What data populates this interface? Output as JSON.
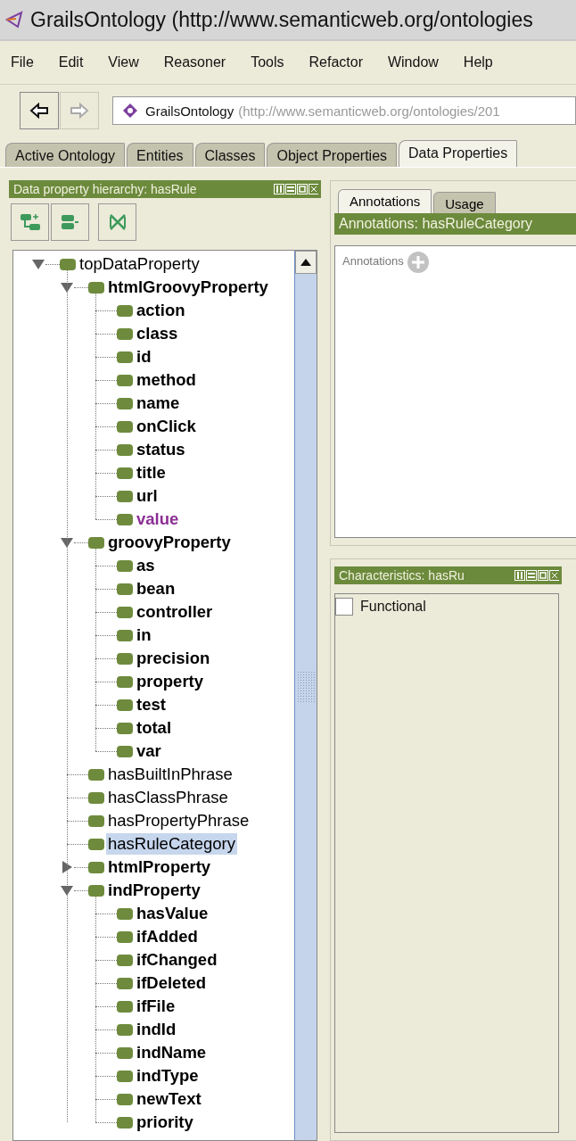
{
  "window": {
    "title": "GrailsOntology (http://www.semanticweb.org/ontologies"
  },
  "menu": [
    "File",
    "Edit",
    "View",
    "Reasoner",
    "Tools",
    "Refactor",
    "Window",
    "Help"
  ],
  "nav_buttons": [
    {
      "kind": "back",
      "disabled": false
    },
    {
      "kind": "forward",
      "disabled": true
    }
  ],
  "address": {
    "name": "GrailsOntology",
    "iri": "(http://www.semanticweb.org/ontologies/201"
  },
  "tabs": [
    {
      "label": "Active Ontology",
      "selected": false
    },
    {
      "label": "Entities",
      "selected": false
    },
    {
      "label": "Classes",
      "selected": false
    },
    {
      "label": "Object Properties",
      "selected": false
    },
    {
      "label": "Data Properties",
      "selected": true
    }
  ],
  "hierarchy_panel": {
    "title": "Data property hierarchy: hasRule",
    "tree": [
      {
        "label": "topDataProperty",
        "bold": false,
        "color": "#000000",
        "selected": false,
        "expanded": true,
        "children": [
          {
            "label": "htmlGroovyProperty",
            "bold": true,
            "color": "#000000",
            "selected": false,
            "expanded": true,
            "children": [
              {
                "label": "action",
                "bold": true,
                "color": "#000000",
                "selected": false
              },
              {
                "label": "class",
                "bold": true,
                "color": "#000000",
                "selected": false
              },
              {
                "label": "id",
                "bold": true,
                "color": "#000000",
                "selected": false
              },
              {
                "label": "method",
                "bold": true,
                "color": "#000000",
                "selected": false
              },
              {
                "label": "name",
                "bold": true,
                "color": "#000000",
                "selected": false
              },
              {
                "label": "onClick",
                "bold": true,
                "color": "#000000",
                "selected": false
              },
              {
                "label": "status",
                "bold": true,
                "color": "#000000",
                "selected": false
              },
              {
                "label": "title",
                "bold": true,
                "color": "#000000",
                "selected": false
              },
              {
                "label": "url",
                "bold": true,
                "color": "#000000",
                "selected": false
              },
              {
                "label": "value",
                "bold": true,
                "color": "#8b2f94",
                "selected": false
              }
            ]
          },
          {
            "label": "groovyProperty",
            "bold": true,
            "color": "#000000",
            "selected": false,
            "expanded": true,
            "children": [
              {
                "label": "as",
                "bold": true,
                "color": "#000000",
                "selected": false
              },
              {
                "label": "bean",
                "bold": true,
                "color": "#000000",
                "selected": false
              },
              {
                "label": "controller",
                "bold": true,
                "color": "#000000",
                "selected": false
              },
              {
                "label": "in",
                "bold": true,
                "color": "#000000",
                "selected": false
              },
              {
                "label": "precision",
                "bold": true,
                "color": "#000000",
                "selected": false
              },
              {
                "label": "property",
                "bold": true,
                "color": "#000000",
                "selected": false
              },
              {
                "label": "test",
                "bold": true,
                "color": "#000000",
                "selected": false
              },
              {
                "label": "total",
                "bold": true,
                "color": "#000000",
                "selected": false
              },
              {
                "label": "var",
                "bold": true,
                "color": "#000000",
                "selected": false
              }
            ]
          },
          {
            "label": "hasBuiltInPhrase",
            "bold": false,
            "color": "#000000",
            "selected": false
          },
          {
            "label": "hasClassPhrase",
            "bold": false,
            "color": "#000000",
            "selected": false
          },
          {
            "label": "hasPropertyPhrase",
            "bold": false,
            "color": "#000000",
            "selected": false
          },
          {
            "label": "hasRuleCategory",
            "bold": false,
            "color": "#000000",
            "selected": true
          },
          {
            "label": "htmlProperty",
            "bold": true,
            "color": "#000000",
            "selected": false,
            "expanded": false
          },
          {
            "label": "indProperty",
            "bold": true,
            "color": "#000000",
            "selected": false,
            "expanded": true,
            "children": [
              {
                "label": "hasValue",
                "bold": true,
                "color": "#000000",
                "selected": false
              },
              {
                "label": "ifAdded",
                "bold": true,
                "color": "#000000",
                "selected": false
              },
              {
                "label": "ifChanged",
                "bold": true,
                "color": "#000000",
                "selected": false
              },
              {
                "label": "ifDeleted",
                "bold": true,
                "color": "#000000",
                "selected": false
              },
              {
                "label": "ifFile",
                "bold": true,
                "color": "#000000",
                "selected": false
              },
              {
                "label": "indId",
                "bold": true,
                "color": "#000000",
                "selected": false
              },
              {
                "label": "indName",
                "bold": true,
                "color": "#000000",
                "selected": false
              },
              {
                "label": "indType",
                "bold": true,
                "color": "#000000",
                "selected": false
              },
              {
                "label": "newText",
                "bold": true,
                "color": "#000000",
                "selected": false
              },
              {
                "label": "priority",
                "bold": true,
                "color": "#000000",
                "selected": false
              }
            ]
          }
        ]
      }
    ]
  },
  "annotations_panel": {
    "tabs": [
      {
        "label": "Annotations",
        "selected": true
      },
      {
        "label": "Usage",
        "selected": false
      }
    ],
    "title": "Annotations: hasRuleCategory",
    "label": "Annotations"
  },
  "characteristics_panel": {
    "title": "Characteristics: hasRu",
    "items": [
      {
        "label": "Functional",
        "checked": false
      }
    ]
  }
}
